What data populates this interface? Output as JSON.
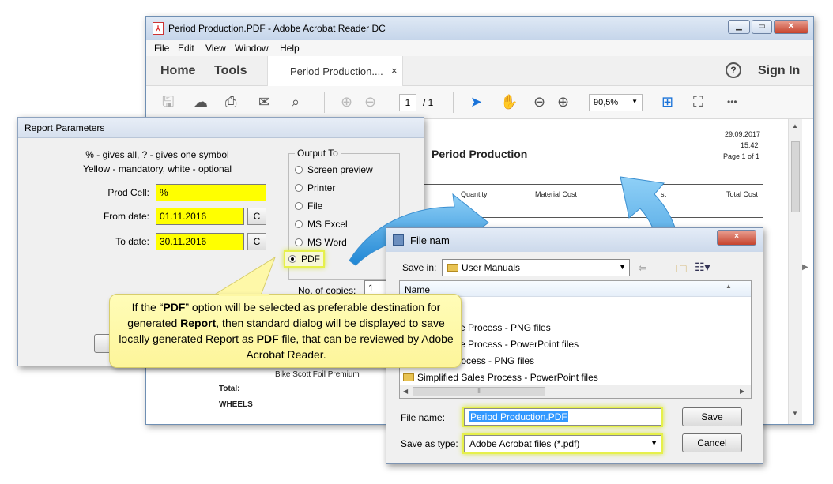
{
  "acrobat": {
    "title": "Period Production.PDF - Adobe Acrobat Reader DC",
    "menu": [
      "File",
      "Edit",
      "View",
      "Window",
      "Help"
    ],
    "nav_home": "Home",
    "nav_tools": "Tools",
    "tab_label": "Period Production....",
    "tab_close": "×",
    "help_glyph": "?",
    "sign_in": "Sign In",
    "page_current": "1",
    "page_total": "/ 1",
    "zoom": "90,5%",
    "more": "•••",
    "doc": {
      "date": "29.09.2017",
      "time": "15:42",
      "page": "Page 1 of 1",
      "heading": "Period Production",
      "col_quantity": "Quantity",
      "col_material_cost": "Material Cost",
      "col_cost_fragment": "st",
      "col_total_cost": "Total Cost",
      "product": "Bike Scott Foil Premium",
      "total": "Total:",
      "group": "WHEELS"
    }
  },
  "report": {
    "title": "Report Parameters",
    "hint1": "% - gives all, ? - gives one symbol",
    "hint2": "Yellow - mandatory, white - optional",
    "prod_cell_label": "Prod Cell:",
    "prod_cell_value": "%",
    "from_label": "From date:",
    "from_value": "01.11.2016",
    "to_label": "To date:",
    "to_value": "30.11.2016",
    "c_button": "C",
    "output_to": "Output To",
    "options": [
      "Screen preview",
      "Printer",
      "File",
      "MS Excel",
      "MS Word",
      "PDF"
    ],
    "selected_option": "PDF",
    "copies_label": "No. of copies:",
    "copies_value": "1"
  },
  "save_dialog": {
    "title": "File nam",
    "save_in_label": "Save in:",
    "save_in_value": "User Manuals",
    "list_header": "Name",
    "items": [
      "d Purchase Process - PNG files",
      "d Purchase Process - PowerPoint files",
      "d Sales Process - PNG files",
      "Simplified Sales Process - PowerPoint files"
    ],
    "hscroll_grip": "III",
    "file_name_label": "File name:",
    "file_name_value": "Period Production.PDF",
    "save_type_label": "Save as type:",
    "save_type_value": "Adobe Acrobat files (*.pdf)",
    "save_button": "Save",
    "cancel_button": "Cancel",
    "close": "×"
  },
  "callout": {
    "t1": "If the “",
    "b1": "PDF",
    "t2": "” option will be selected as preferable destination for generated ",
    "b2": "Report",
    "t3": ", then standard dialog will be displayed to save locally generated Report as ",
    "b3": "PDF",
    "t4": " file, that can be reviewed by Adobe Acrobat Reader."
  },
  "colors": {
    "mandatory_field": "#ffff00",
    "callout_bg": "#fdf59a",
    "arrow": "#2e9be0",
    "highlight": "#e6f04a"
  }
}
